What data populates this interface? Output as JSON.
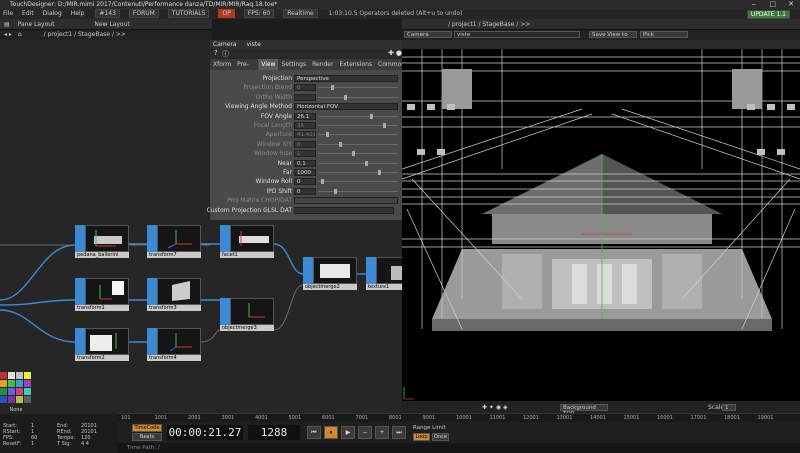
{
  "window": {
    "title": "TouchDesigner: D:/MIR.mimi 2017/Contenuti/Performance danza/TD/MIR/MIR/Raq.18.toe*"
  },
  "menu": [
    "File",
    "Edit",
    "Dialog",
    "Help"
  ],
  "menu_chips": [
    "#143",
    "FORUM",
    "TUTORIALS",
    "OP",
    "FPS: 60",
    "Realtime"
  ],
  "status_message": "1:03:10.5 Operators deleted (Alt+u to undo)",
  "update_label": "UPDATE 1.1",
  "network": {
    "pane_layout": "Pane Layout",
    "new_layout": "New Layout",
    "path": "/ project1 / StageBase / >>"
  },
  "viewer": {
    "path": "/ project1 / StageBase / >>",
    "camera_dd": "Camera",
    "camera_name": "viste",
    "save_view": "Save View to",
    "pick": "Pick",
    "background_top": "Background TOP",
    "scale_label": "Scale",
    "scale_value": "1"
  },
  "camera_panel": {
    "header_type": "Camera",
    "header_name": "viste",
    "tabs": [
      "Xform",
      "Pre-Xform",
      "View",
      "Settings",
      "Render",
      "Extensions",
      "Common"
    ],
    "active_tab": "View",
    "params": [
      {
        "label": "Projection",
        "value": "Perspective",
        "dim": false,
        "slider": false
      },
      {
        "label": "Projection Blend",
        "value": "0",
        "dim": true,
        "slider": true
      },
      {
        "label": "Ortho Width",
        "value": "",
        "dim": true,
        "slider": true
      },
      {
        "label": "Viewing Angle Method",
        "value": "Horizontal FOV",
        "dim": false,
        "slider": false
      },
      {
        "label": "FOV Angle",
        "value": "26.1",
        "dim": false,
        "slider": true
      },
      {
        "label": "Focal Length",
        "value": "35",
        "dim": true,
        "slider": true
      },
      {
        "label": "Aperture",
        "value": "41.421",
        "dim": true,
        "slider": true
      },
      {
        "label": "Window X/Y",
        "value": "0",
        "dim": true,
        "slider": true
      },
      {
        "label": "Window Size",
        "value": "1",
        "dim": true,
        "slider": true
      },
      {
        "label": "Near",
        "value": "0.1",
        "dim": false,
        "slider": true
      },
      {
        "label": "Far",
        "value": "1000",
        "dim": false,
        "slider": true
      },
      {
        "label": "Window Roll",
        "value": "0",
        "dim": false,
        "slider": true
      },
      {
        "label": "IPD Shift",
        "value": "0",
        "dim": false,
        "slider": true
      },
      {
        "label": "Proj Matrix CHOP/DAT",
        "value": "",
        "dim": true,
        "slider": false
      },
      {
        "label": "Custom Projection GLSL DAT",
        "value": "",
        "dim": false,
        "slider": false
      }
    ]
  },
  "nodes": [
    {
      "name": "pedana_ballerini",
      "thumb": "pedana"
    },
    {
      "name": "transform7",
      "thumb": "axis"
    },
    {
      "name": "facet1",
      "thumb": "facet"
    },
    {
      "name": "objectmerge2",
      "thumb": "merge"
    },
    {
      "name": "texture1",
      "thumb": "texture"
    },
    {
      "name": "transform1",
      "thumb": "glow"
    },
    {
      "name": "transform3",
      "thumb": "plane"
    },
    {
      "name": "objectmerge3",
      "thumb": "axis"
    },
    {
      "name": "transform2",
      "thumb": "white"
    },
    {
      "name": "transform4",
      "thumb": "axis"
    }
  ],
  "palette_label": "None",
  "timeline": {
    "ruler": [
      "101",
      "1001",
      "2001",
      "3001",
      "4001",
      "5001",
      "6001",
      "7001",
      "8001",
      "9001",
      "10001",
      "11001",
      "12001",
      "13001",
      "14001",
      "15001",
      "16001",
      "17001",
      "18001",
      "19001"
    ],
    "timecode_label": "TimeCode",
    "beats_label": "Beats",
    "timecode": "00:00:21.27",
    "frame": "1288",
    "range_limit": "Range Limit",
    "loop": "Loop",
    "once": "Once",
    "time_path": "Time Path: /"
  },
  "info": {
    "start": "1",
    "end": "20101",
    "rstart": "1",
    "rend": "20101",
    "fps": "60",
    "tempo": "120",
    "resetf": "1",
    "tsig": "4   4"
  },
  "colors": {
    "accent": "#3a8ad6",
    "panel": "#4a4a4a",
    "active": "#d4892a"
  }
}
